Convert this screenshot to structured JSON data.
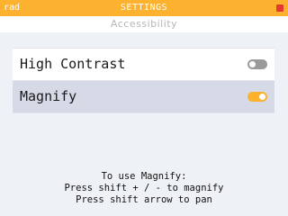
{
  "status_bar": {
    "left_text": "rad",
    "title": "SETTINGS",
    "battery_color": "#e23a2f"
  },
  "subtitle": "Accessibility",
  "settings": [
    {
      "label": "High Contrast",
      "enabled": false,
      "selected": false
    },
    {
      "label": "Magnify",
      "enabled": true,
      "selected": true
    }
  ],
  "help": {
    "lines": [
      "To use Magnify:",
      "Press shift + / - to magnify",
      "Press shift arrow to pan"
    ]
  },
  "colors": {
    "accent": "#fcb22f",
    "toggle_off": "#9a9a9a",
    "selected_row": "#d6d9e6"
  }
}
